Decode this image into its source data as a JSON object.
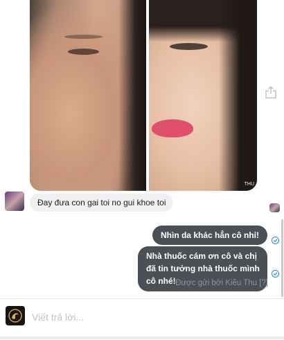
{
  "photo": {
    "watermark": "THU"
  },
  "conversation": {
    "incoming": [
      {
        "text": "Đay đưa con gai toi no gui khoe toi"
      }
    ],
    "outgoing": [
      {
        "text": "Nhìn da khác hẳn cô nhỉ!"
      },
      {
        "text": "Nhà thuốc cám ơn cô và chị đã tin tưởng nhà thuốc mình cô nhé!"
      }
    ],
    "sent_by": "Được gửi bởi Kiều Thu [?]"
  },
  "reply": {
    "placeholder": "Viết trả lời..."
  },
  "icons": {
    "share": "share-icon",
    "seen": "check-circle-icon"
  },
  "colors": {
    "outgoing_bubble": "#4b4f56",
    "incoming_bubble": "#f1f0f0",
    "seen_check": "#2a86d8",
    "sent_by_text": "#90949c"
  }
}
